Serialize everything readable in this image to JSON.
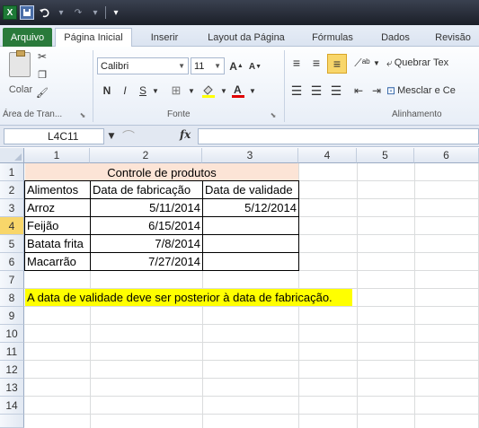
{
  "titlebar": {
    "app_icon_text": "X",
    "quick_access": [
      "save-icon",
      "undo-icon",
      "redo-icon",
      "customize-icon"
    ]
  },
  "tabs": {
    "file": "Arquivo",
    "items": [
      "Página Inicial",
      "Inserir",
      "Layout da Página",
      "Fórmulas",
      "Dados",
      "Revisão"
    ]
  },
  "ribbon": {
    "clipboard": {
      "paste_label": "Colar",
      "group_label": "Área de Tran..."
    },
    "font": {
      "font_name": "Calibri",
      "font_size": "11",
      "bold": "N",
      "italic": "I",
      "underline": "S",
      "group_label": "Fonte"
    },
    "alignment": {
      "wrap_text": "Quebrar Tex",
      "merge_center": "Mesclar e Ce",
      "group_label": "Alinhamento"
    }
  },
  "formula_bar": {
    "name_box": "L4C11",
    "fx_label": "fx",
    "content": ""
  },
  "grid": {
    "column_headers": [
      "1",
      "2",
      "3",
      "4",
      "5",
      "6"
    ],
    "row_headers": [
      "1",
      "2",
      "3",
      "4",
      "5",
      "6",
      "7",
      "8",
      "9",
      "10",
      "11",
      "12",
      "13",
      "14"
    ],
    "title_cell": "Controle de produtos",
    "table_headers": [
      "Alimentos",
      "Data de fabricação",
      "Data de validade"
    ],
    "rows": [
      {
        "food": "Arroz",
        "manufacture": "5/11/2014",
        "expiry": "5/12/2014"
      },
      {
        "food": "Feijão",
        "manufacture": "6/15/2014",
        "expiry": ""
      },
      {
        "food": "Batata frita",
        "manufacture": "7/8/2014",
        "expiry": ""
      },
      {
        "food": "Macarrão",
        "manufacture": "7/27/2014",
        "expiry": ""
      }
    ],
    "note": "A data de validade deve ser posterior à data de fabricação.",
    "colors": {
      "title_fill": "#fce4d6",
      "note_fill": "#ffff00",
      "selected_row_header": "#f8d66a"
    }
  }
}
